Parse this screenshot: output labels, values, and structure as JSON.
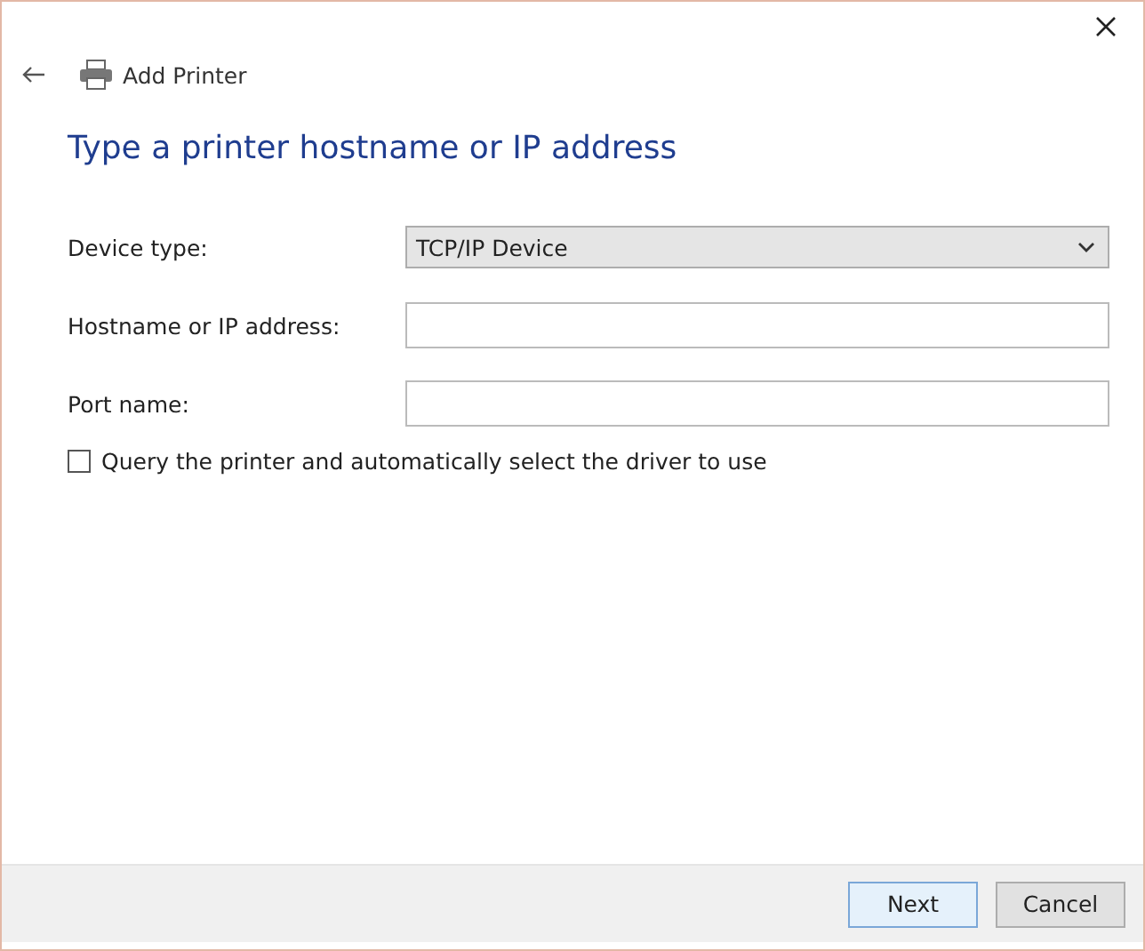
{
  "window": {
    "title": "Add Printer"
  },
  "heading": "Type a printer hostname or IP address",
  "fields": [
    {
      "kind": "select",
      "label": "Device type:",
      "value": "TCP/IP Device"
    },
    {
      "kind": "text",
      "label": "Hostname or IP address:"
    },
    {
      "kind": "text",
      "label": "Port name:"
    }
  ],
  "query_option": {
    "label": "Query the printer and automatically select the driver to use",
    "checked": false
  },
  "buttons": [
    {
      "label": "Next",
      "default": true
    },
    {
      "label": "Cancel",
      "default": false
    }
  ]
}
